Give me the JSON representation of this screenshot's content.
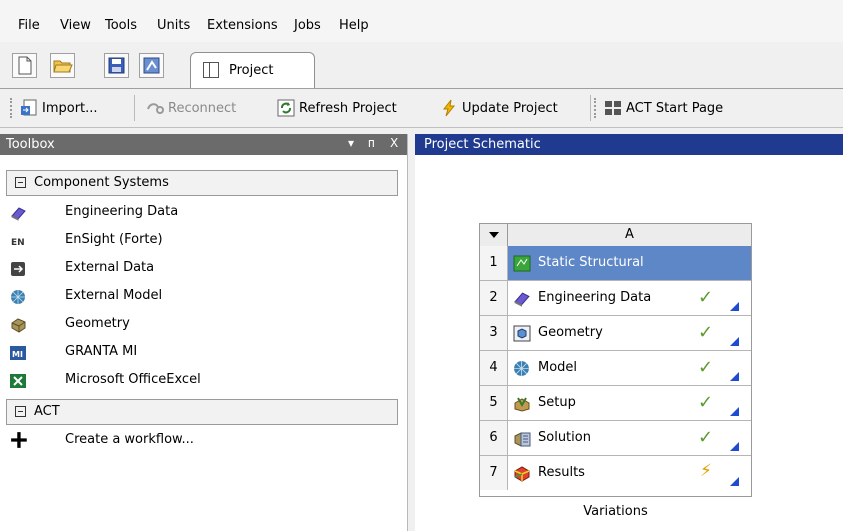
{
  "menu": [
    "File",
    "View",
    "Tools",
    "Units",
    "Extensions",
    "Jobs",
    "Help"
  ],
  "tab": {
    "label": "Project"
  },
  "toolbar": {
    "import": "Import...",
    "reconnect": "Reconnect",
    "refresh": "Refresh Project",
    "update": "Update Project",
    "act_start": "ACT Start Page"
  },
  "toolbox": {
    "title": "Toolbox",
    "controls": [
      "▾",
      "ᴨ",
      "X"
    ],
    "groups": [
      {
        "label": "Component Systems",
        "items": [
          {
            "label": "Engineering Data",
            "icon": "book-icon"
          },
          {
            "label": "EnSight (Forte)",
            "icon": "ensight-icon"
          },
          {
            "label": "External Data",
            "icon": "external-data-icon"
          },
          {
            "label": "External Model",
            "icon": "mesh-icon"
          },
          {
            "label": "Geometry",
            "icon": "geometry-icon"
          },
          {
            "label": "GRANTA MI",
            "icon": "granta-icon"
          },
          {
            "label": "Microsoft OfficeExcel",
            "icon": "excel-icon"
          }
        ]
      },
      {
        "label": "ACT",
        "items": [
          {
            "label": "Create a workflow...",
            "icon": "plus-icon"
          }
        ]
      }
    ]
  },
  "schematic": {
    "title": "Project Schematic",
    "system": {
      "column": "A",
      "rows": [
        {
          "num": "1",
          "label": "Static Structural",
          "status": "",
          "icon": "static-structural-icon"
        },
        {
          "num": "2",
          "label": "Engineering Data",
          "status": "✓",
          "icon": "book-icon"
        },
        {
          "num": "3",
          "label": "Geometry",
          "status": "✓",
          "icon": "geometry-cube-icon"
        },
        {
          "num": "4",
          "label": "Model",
          "status": "✓",
          "icon": "mesh-icon"
        },
        {
          "num": "5",
          "label": "Setup",
          "status": "✓",
          "icon": "setup-icon"
        },
        {
          "num": "6",
          "label": "Solution",
          "status": "✓",
          "icon": "solution-icon"
        },
        {
          "num": "7",
          "label": "Results",
          "status": "⚡",
          "icon": "results-icon"
        }
      ]
    },
    "variations": "Variations"
  }
}
